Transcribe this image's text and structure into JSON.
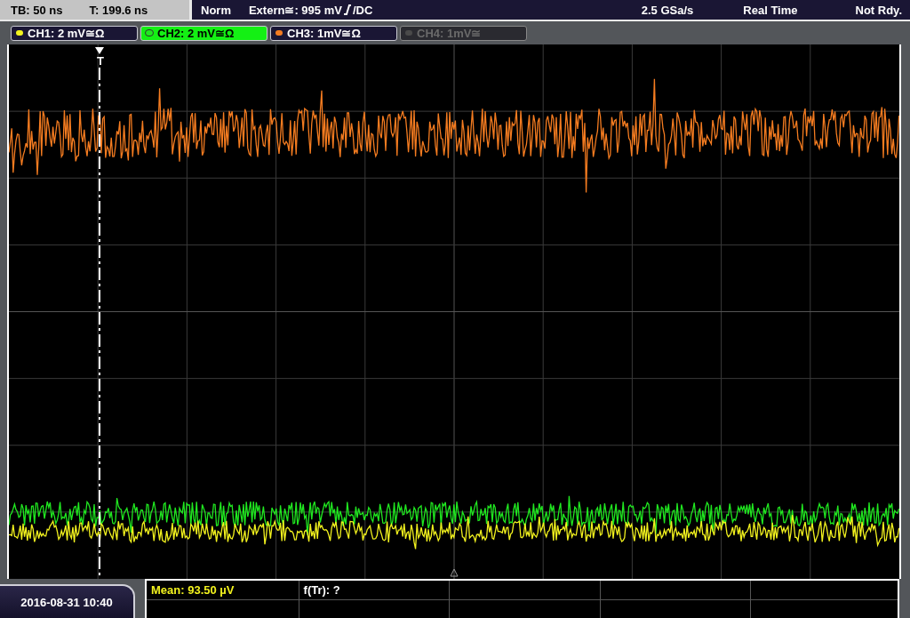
{
  "header": {
    "timebase": "TB: 50 ns",
    "trigger_time": "T: 199.6 ns",
    "mode": "Norm",
    "trigger_source": "Extern≅: 995 mV",
    "coupling": "/DC",
    "sample_rate": "2.5 GSa/s",
    "acquisition": "Real Time",
    "status": "Not Rdy."
  },
  "channels": [
    {
      "label": "CH1: 2 mV≅Ω",
      "color": "#f2f21e",
      "selected": false,
      "disabled": false
    },
    {
      "label": "CH2: 2 mV≅Ω",
      "color": "#20e820",
      "selected": true,
      "disabled": false
    },
    {
      "label": "CH3: 1mV≅Ω",
      "color": "#f57c20",
      "selected": false,
      "disabled": false
    },
    {
      "label": "CH4: 1mV≅",
      "color": "#4a4a4a",
      "selected": false,
      "disabled": true
    }
  ],
  "trigger_marker": "T",
  "datetime": "2016-08-31 10:40",
  "measurements": [
    {
      "text": "Mean: 93.50 µV",
      "kind": "mean"
    },
    {
      "text": "f(Tr): ?",
      "kind": "plain"
    }
  ]
}
